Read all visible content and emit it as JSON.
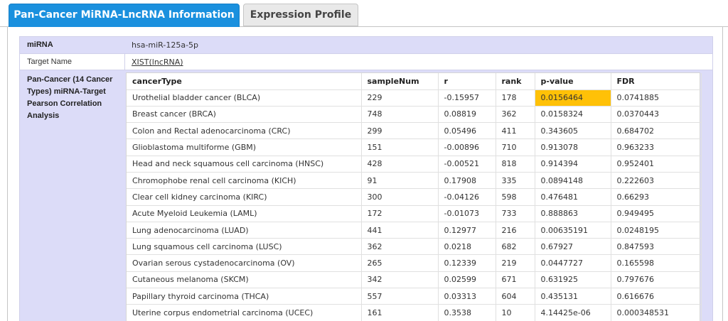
{
  "tabs": [
    {
      "label": "Pan-Cancer MiRNA-LncRNA Information"
    },
    {
      "label": "Expression Profile"
    }
  ],
  "info": {
    "mirna_label": "miRNA",
    "mirna_value": "hsa-miR-125a-5p",
    "target_label": "Target Name",
    "target_value": "XIST(lncRNA)",
    "analysis_label": "Pan-Cancer (14 Cancer Types) miRNA-Target Pearson Correlation Analysis"
  },
  "table": {
    "headers": [
      "cancerType",
      "sampleNum",
      "r",
      "rank",
      "p-value",
      "FDR"
    ],
    "rows": [
      [
        "Urothelial bladder cancer (BLCA)",
        "229",
        "-0.15957",
        "178",
        "0.0156464",
        "0.0741885"
      ],
      [
        "Breast cancer (BRCA)",
        "748",
        "0.08819",
        "362",
        "0.0158324",
        "0.0370443"
      ],
      [
        "Colon and Rectal adenocarcinoma (CRC)",
        "299",
        "0.05496",
        "411",
        "0.343605",
        "0.684702"
      ],
      [
        "Glioblastoma multiforme (GBM)",
        "151",
        "-0.00896",
        "710",
        "0.913078",
        "0.963233"
      ],
      [
        "Head and neck squamous cell carcinoma (HNSC)",
        "428",
        "-0.00521",
        "818",
        "0.914394",
        "0.952401"
      ],
      [
        "Chromophobe renal cell carcinoma (KICH)",
        "91",
        "0.17908",
        "335",
        "0.0894148",
        "0.222603"
      ],
      [
        "Clear cell kidney carcinoma (KIRC)",
        "300",
        "-0.04126",
        "598",
        "0.476481",
        "0.66293"
      ],
      [
        "Acute Myeloid Leukemia (LAML)",
        "172",
        "-0.01073",
        "733",
        "0.888863",
        "0.949495"
      ],
      [
        "Lung adenocarcinoma (LUAD)",
        "441",
        "0.12977",
        "216",
        "0.00635191",
        "0.0248195"
      ],
      [
        "Lung squamous cell carcinoma (LUSC)",
        "362",
        "0.0218",
        "682",
        "0.67927",
        "0.847593"
      ],
      [
        "Ovarian serous cystadenocarcinoma (OV)",
        "265",
        "0.12339",
        "219",
        "0.0447727",
        "0.165598"
      ],
      [
        "Cutaneous melanoma (SKCM)",
        "342",
        "0.02599",
        "671",
        "0.631925",
        "0.797676"
      ],
      [
        "Papillary thyroid carcinoma (THCA)",
        "557",
        "0.03313",
        "604",
        "0.435131",
        "0.616676"
      ],
      [
        "Uterine corpus endometrial carcinoma (UCEC)",
        "161",
        "0.3538",
        "10",
        "4.14425e-06",
        "0.000348531"
      ]
    ],
    "highlight_color": "#ffc107"
  }
}
